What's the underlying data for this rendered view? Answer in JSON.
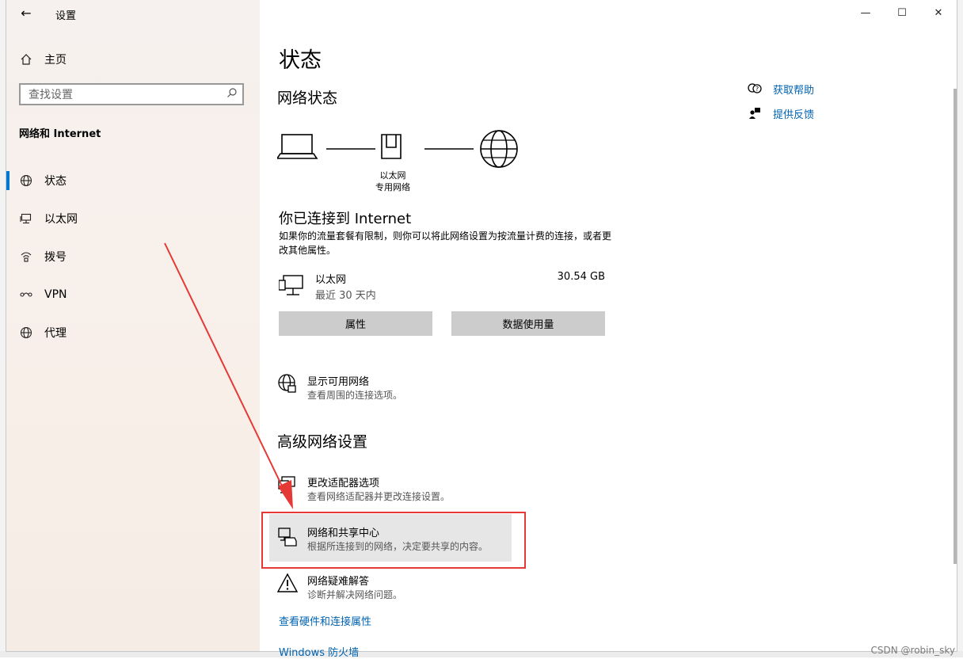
{
  "app": {
    "title": "设置",
    "back_glyph": "←"
  },
  "sidebar": {
    "home_label": "主页",
    "search_placeholder": "查找设置",
    "section_title": "网络和 Internet",
    "items": [
      {
        "label": "状态",
        "icon": "globe-icon",
        "active": true
      },
      {
        "label": "以太网",
        "icon": "ethernet-icon",
        "active": false
      },
      {
        "label": "拨号",
        "icon": "dialup-icon",
        "active": false
      },
      {
        "label": "VPN",
        "icon": "vpn-icon",
        "active": false
      },
      {
        "label": "代理",
        "icon": "globe-icon",
        "active": false
      }
    ]
  },
  "window_controls": {
    "minimize": "—",
    "maximize": "☐",
    "close": "✕"
  },
  "main": {
    "title": "状态",
    "network_status_heading": "网络状态",
    "diagram_label_line1": "以太网",
    "diagram_label_line2": "专用网络",
    "connected_title": "你已连接到 Internet",
    "connected_desc": "如果你的流量套餐有限制，则你可以将此网络设置为按流量计费的连接，或者更改其他属性。",
    "adapter": {
      "name": "以太网",
      "sub": "最近 30 天内",
      "usage": "30.54 GB"
    },
    "buttons": {
      "properties": "属性",
      "data_usage": "数据使用量"
    },
    "show_networks": {
      "title": "显示可用网络",
      "desc": "查看周围的连接选项。"
    },
    "advanced_heading": "高级网络设置",
    "adapter_options": {
      "title": "更改适配器选项",
      "desc": "查看网络适配器并更改连接设置。"
    },
    "sharing_center": {
      "title": "网络和共享中心",
      "desc": "根据所连接到的网络，决定要共享的内容。"
    },
    "troubleshooter": {
      "title": "网络疑难解答",
      "desc": "诊断并解决网络问题。"
    },
    "link_hardware": "查看硬件和连接属性",
    "link_firewall": "Windows 防火墙"
  },
  "help": {
    "get_help": "获取帮助",
    "feedback": "提供反馈"
  },
  "watermark": "CSDN @robin_sky",
  "colors": {
    "accent": "#0078d4",
    "link": "#0063b1",
    "annotation": "#e53935"
  }
}
